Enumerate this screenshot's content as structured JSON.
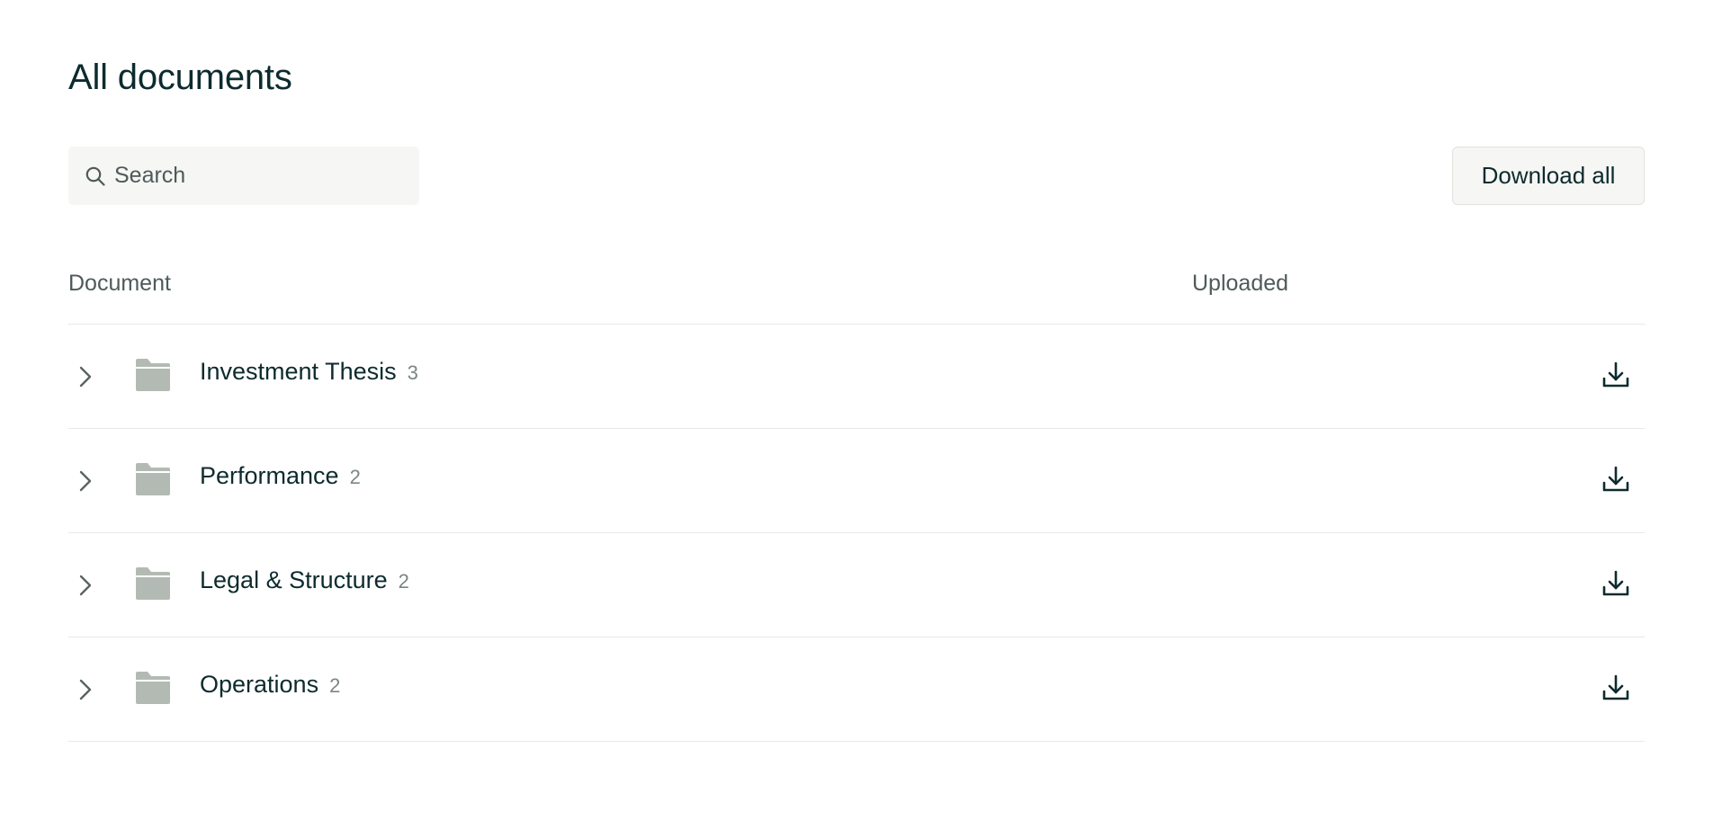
{
  "page": {
    "title": "All documents"
  },
  "toolbar": {
    "search_placeholder": "Search",
    "search_icon": "search-icon",
    "download_all_label": "Download all"
  },
  "table": {
    "columns": [
      "Document",
      "Uploaded"
    ],
    "rows": [
      {
        "name": "Investment Thesis",
        "count": "3",
        "uploaded": ""
      },
      {
        "name": "Performance",
        "count": "2",
        "uploaded": ""
      },
      {
        "name": "Legal & Structure",
        "count": "2",
        "uploaded": ""
      },
      {
        "name": "Operations",
        "count": "2",
        "uploaded": ""
      }
    ]
  },
  "icons": {
    "row_expand": "chevron-right-icon",
    "row_type": "folder-icon",
    "row_action": "download-icon"
  },
  "colors": {
    "text_primary": "#0d2b2e",
    "text_secondary": "#4e5a5a",
    "folder": "#b3bab3",
    "surface": "#f6f6f4",
    "divider": "#e8e8e6"
  }
}
